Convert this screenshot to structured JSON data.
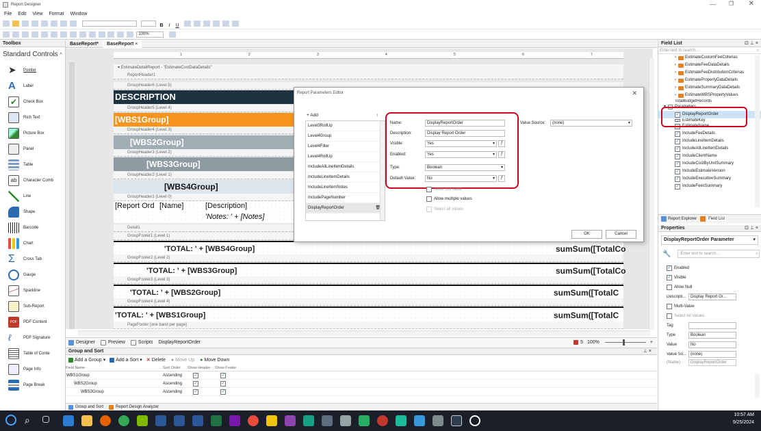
{
  "window": {
    "title": "Report Designer"
  },
  "menu": [
    "File",
    "Edit",
    "View",
    "Format",
    "Window"
  ],
  "toolbar": {
    "zoom": "100%"
  },
  "toolbox": {
    "title": "Toolbox",
    "category": "Standard Controls",
    "items": [
      "Pointer",
      "Label",
      "Check Box",
      "Rich Text",
      "Picture Box",
      "Panel",
      "Table",
      "Character Comb",
      "Line",
      "Shape",
      "Barcode",
      "Chart",
      "Cross Tab",
      "Gauge",
      "Sparkline",
      "Sub-Report",
      "PDF Content",
      "PDF Signature",
      "Table of Conte",
      "Page Info",
      "Page Break"
    ]
  },
  "tabs": [
    {
      "label": "BaseReport*"
    },
    {
      "label": "BaseReport",
      "close": "×"
    }
  ],
  "report": {
    "root": "EstimateDetailReport - \"EstimateCostDataDetails\"",
    "bands": {
      "report_header": "ReportHeader1",
      "gh6": "GroupHeader6 (Level 5)",
      "gh5": "GroupHeader5 (Level 4)",
      "gh4": "GroupHeader4 (Level 3)",
      "gh3": "GroupHeader3 (Level 2)",
      "gh2": "GroupHeader2 (Level 1)",
      "gh1": "GroupHeader1 (Level 0)",
      "detail": "Detail1",
      "gf1": "GroupFooter1 (Level 1)",
      "gf2": "GroupFooter2 (Level 2)",
      "gf3": "GroupFooter3 (Level 3)",
      "gf4": "GroupFooter4 (Level 4)",
      "page_footer": "PageFooter [one band per page]"
    },
    "description": "DESCRIPTION",
    "wbs1": "[WBS1Group]",
    "wbs2": "[WBS2Group]",
    "wbs3": "[WBS3Group]",
    "wbs4": "[WBS4Group]",
    "detail_order": "[Report Ord",
    "detail_name": "[Name]",
    "detail_desc": "[Description]",
    "detail_notes": "'Notes: ' + [Notes]",
    "total4": "'TOTAL: ' + [WBS4Group]",
    "total3": "'TOTAL: ' + [WBS3Group]",
    "total2": "'TOTAL: ' + [WBS2Group]",
    "total1": "'TOTAL: ' + [WBS1Group]",
    "sum1": "sumSum([TotalCo",
    "sum2": "sumSum([TotalCo",
    "sum3": "sumSum([TotalC",
    "sum4": "sumSum([TotalC"
  },
  "bottom_tabs": [
    "Designer",
    "Preview",
    "Scripts",
    "DisplayReportOrder"
  ],
  "zoom_status": {
    "count": "5",
    "zoom": "100%"
  },
  "group_sort": {
    "title": "Group and Sort",
    "actions": [
      "Add a Group",
      "Add a Sort",
      "Delete",
      "Move Up",
      "Move Down"
    ],
    "columns": [
      "Field Name",
      "Sort Order",
      "Show Header",
      "Show Footer"
    ],
    "rows": [
      {
        "name": "WBS1Group",
        "order": "Ascending"
      },
      {
        "name": "WBS2Group",
        "order": "Ascending"
      },
      {
        "name": "WBS3Group",
        "order": "Ascending"
      }
    ],
    "footer_tabs": [
      "Group and Sort",
      "Report Design Analyzer"
    ]
  },
  "dialog": {
    "title": "Report Parameters Editor",
    "add": "Add",
    "params": [
      "Level3RollUp",
      "Level4Group",
      "Level4Filter",
      "Level4RollUp",
      "IncludeAllLineItemDetails",
      "IncludeLineItemDetails",
      "IncludeLineItemNotes",
      "IncludePageNumber",
      "DisplayReportOrder"
    ],
    "name_label": "Name:",
    "name_value": "DisplayReportOrder",
    "desc_label": "Description:",
    "desc_value": "Display Report Order",
    "visible_label": "Visible:",
    "visible_value": "Yes",
    "enabled_label": "Enabled:",
    "enabled_value": "Yes",
    "type_label": "Type:",
    "type_value": "Boolean",
    "default_label": "Default Value:",
    "default_value": "No",
    "allow_null": "Allow null value",
    "allow_multiple": "Allow multiple values",
    "select_all": "Select all values",
    "value_source_label": "Value Source:",
    "value_source_value": "(none)",
    "ok": "OK",
    "cancel": "Cancel"
  },
  "field_list": {
    "title": "Field List",
    "search": "Enter text to search...",
    "data_items": [
      "EstimateCustomFeeCriterias",
      "EstimateFeeDataDetails",
      "EstimateFeeDistributionCriterias",
      "EstimatePropertyDataDetails",
      "EstimateSummaryDataDetails",
      "EstimateWBSPropertyValues",
      "TotalBudgetRecords"
    ],
    "params_node": "Parameters",
    "params": [
      "DisplayReportOrder",
      "EstimateKey",
      "EstimateName",
      "IncludeFeeDetails",
      "IncludeLineItemDetails",
      "IncludeAllLineItemDetails",
      "IncludeClientName",
      "IncludeCostByUnitSummary",
      "IncludeEstimateVersion",
      "IncludeExecutiveSummary",
      "IncludeFeesSummary"
    ],
    "tabs": [
      "Report Explorer",
      "Field List"
    ]
  },
  "properties": {
    "title": "Properties",
    "object": "DisplayReportOrder  Parameter",
    "search": "Enter text to search...",
    "enabled": "Enabled",
    "visible": "Visible",
    "allow_null": "Allow Null",
    "descr_label": "Descripti...",
    "descr_value": "Display Report Or...",
    "multi_value": "Multi-Value",
    "select_all": "Select All Values",
    "tag_label": "Tag",
    "type_label": "Type",
    "type_value": "Boolean",
    "value_label": "Value",
    "value_value": "No",
    "value_source_label": "Value So...",
    "value_source_value": "(none)",
    "name_label": "(Name)",
    "name_value": "DisplayReportOrder"
  },
  "taskbar": {
    "time": "10:57 AM",
    "date": "9/25/2024"
  },
  "colors": {
    "orange": "#f7941d",
    "dark": "#1e3340",
    "gray": "#a0aeb4",
    "lightgray": "#c4d0d6",
    "red": "#d0021b"
  }
}
